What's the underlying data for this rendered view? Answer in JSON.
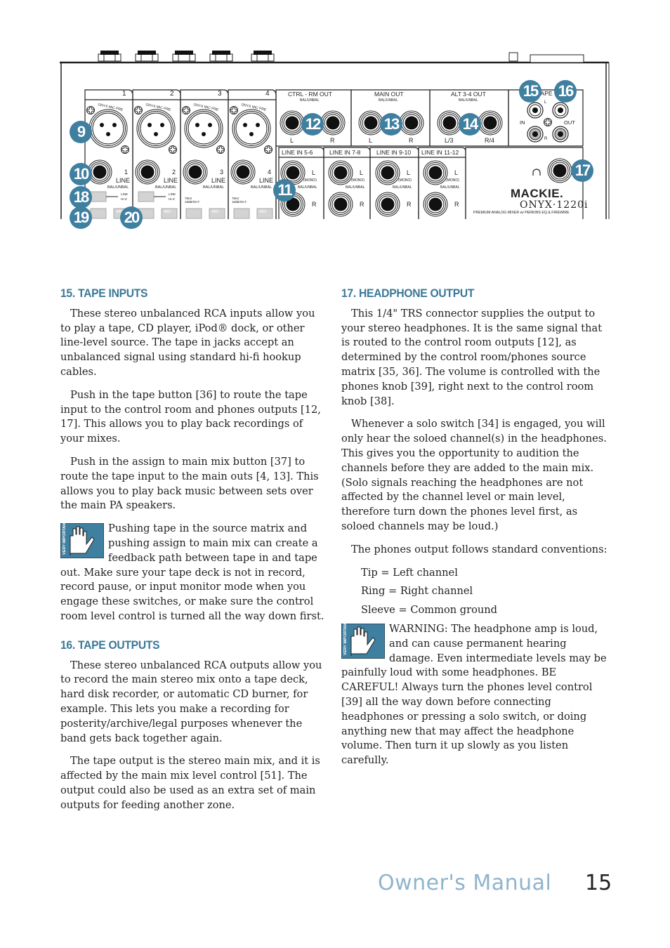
{
  "panel": {
    "channels": [
      {
        "num": "1",
        "line_num": "1",
        "line": "LINE",
        "bal": "BAL/UNBAL"
      },
      {
        "num": "2",
        "line_num": "2",
        "line": "LINE",
        "bal": "BAL/UNBAL"
      },
      {
        "num": "3",
        "line_num": "3",
        "line": "LINE",
        "bal": "BAL/UNBAL"
      },
      {
        "num": "4",
        "line_num": "4",
        "line": "LINE",
        "bal": "BAL/UNBAL"
      }
    ],
    "mic_pre_label": "ONYX MIC PRE",
    "hiz_labels": {
      "line": "LINE",
      "hiz": "HI-Z"
    },
    "filter_label": "75Hz 18dB/OCT",
    "phantom_label": "48V",
    "outputs": [
      {
        "title": "CTRL - RM OUT",
        "sub": "BAL/UNBAL",
        "left": "L",
        "right": "R"
      },
      {
        "title": "MAIN OUT",
        "sub": "BAL/UNBAL",
        "left": "L",
        "right": "R"
      },
      {
        "title": "ALT 3-4 OUT",
        "sub": "BAL/UNBAL",
        "left": "L/3",
        "right": "R/4"
      }
    ],
    "line_ins": [
      {
        "title": "LINE IN 5-6",
        "left": "L",
        "mono": "(MONO)",
        "bal": "BAL/UNBAL",
        "right": "R"
      },
      {
        "title": "LINE IN 7-8",
        "left": "L",
        "mono": "(MONO)",
        "bal": "BAL/UNBAL",
        "right": "R"
      },
      {
        "title": "LINE IN 9-10",
        "left": "L",
        "mono": "(MONO)",
        "bal": "BAL/UNBAL",
        "right": "R"
      },
      {
        "title": "LINE IN 11-12",
        "left": "L",
        "mono": "(MONO)",
        "bal": "BAL/UNBAL",
        "right": "R"
      }
    ],
    "tape": {
      "title": "TAPE",
      "in": "IN",
      "out": "OUT",
      "l": "L",
      "r": "R"
    },
    "brand": "MACKIE.",
    "model": "ONYX·1220i",
    "tagline": "PREMIUM ANALOG MIXER w/ PERKINS EQ & FIREWIRE",
    "callouts": [
      "9",
      "10",
      "11",
      "12",
      "13",
      "14",
      "15",
      "16",
      "17",
      "18",
      "19",
      "20"
    ]
  },
  "section15": {
    "heading": "15. TAPE INPUTS",
    "paragraphs": [
      "These stereo unbalanced RCA inputs allow you to play a tape, CD player, iPod® dock, or other line-level source. The tape in jacks accept an unbalanced signal using standard hi-fi hookup cables.",
      "Push in the tape button [36] to route the tape input to the control room and phones outputs [12, 17]. This allows you to play back recordings of your mixes.",
      "Push in the assign to main mix button [37] to route the tape input to the main outs [4, 13]. This allows you to play back music between sets over the main PA speakers."
    ],
    "warning": "Pushing tape in the source matrix and pushing assign to main mix can create a feedback path between tape in and tape out. Make sure your tape deck is not in record, record pause, or input monitor mode when you engage these switches, or make sure the control room level control is turned all the way down first."
  },
  "section16": {
    "heading": "16. TAPE OUTPUTS",
    "paragraphs": [
      "These stereo unbalanced RCA outputs allow you to record the main stereo mix onto a tape deck, hard disk recorder, or automatic CD burner, for example. This lets you make a recording for posterity/archive/legal purposes whenever the band gets back together again.",
      "The tape output is the stereo main mix, and it is affected by the main mix level control [51]. The output could also be used as an extra set of main outputs for feeding another zone."
    ]
  },
  "section17": {
    "heading": "17. HEADPHONE OUTPUT",
    "paragraphs": [
      "This 1/4\" TRS connector supplies the output to your stereo headphones. It is the same signal that is routed to the control room outputs [12], as determined by the control room/phones source matrix [35, 36]. The volume is controlled with the phones knob [39], right next to the control room knob [38].",
      "Whenever a solo switch [34] is engaged, you will only hear the soloed channel(s) in the headphones. This gives you the opportunity to audition the channels before they are added to the main mix. (Solo signals reaching the headphones are not affected by the channel level or main level, therefore turn down the phones level first, as soloed channels may be loud.)",
      "The phones output follows standard conventions:"
    ],
    "conventions": [
      "Tip = Left channel",
      "Ring = Right channel",
      "Sleeve = Common ground"
    ],
    "warning": "WARNING: The headphone amp is loud, and can cause permanent hearing damage. Even intermediate levels may be painfully loud with some headphones. BE CAREFUL! Always turn the phones level control [39] all the way down before connecting headphones or pressing a solo switch, or doing anything new that may affect the headphone volume. Then turn it up slowly as you listen carefully."
  },
  "warning_icon_label": "VERY IMPORTANT",
  "footer": {
    "title": "Owner's Manual",
    "page": "15"
  },
  "colors": {
    "accent": "#3f7fa0",
    "heading": "#3a7898",
    "footer_title": "#8fb4cc"
  }
}
